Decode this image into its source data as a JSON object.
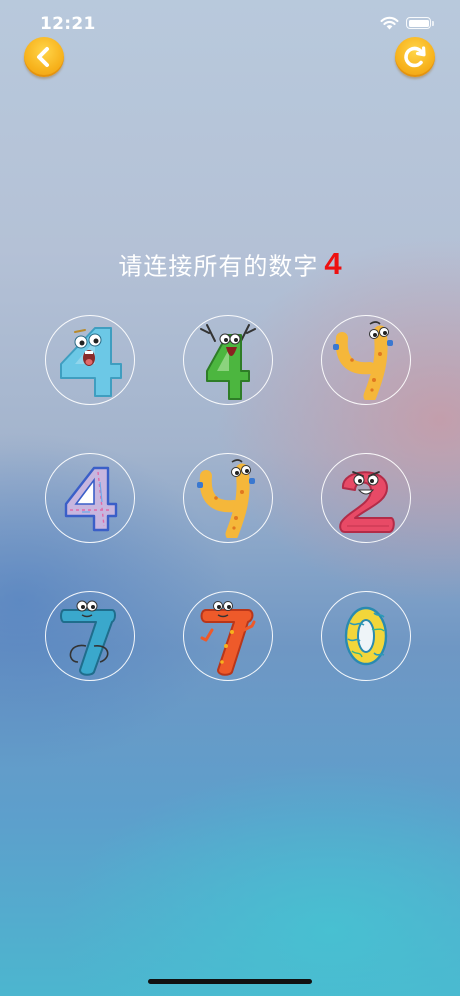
{
  "status_bar": {
    "time": "12:21"
  },
  "prompt": {
    "text": "请连接所有的数字",
    "target": "4"
  },
  "buttons": {
    "back_icon": "chevron-left-icon",
    "restart_icon": "refresh-icon"
  },
  "colors": {
    "button_yellow": "#f7b21c",
    "target_red": "#ee1010"
  },
  "cells": [
    {
      "digit": "4",
      "style": "cyan-cartoon"
    },
    {
      "digit": "4",
      "style": "green-cartoon"
    },
    {
      "digit": "4",
      "style": "yellow-cartoon"
    },
    {
      "digit": "4",
      "style": "blue-outline-pattern"
    },
    {
      "digit": "4",
      "style": "yellow-cartoon"
    },
    {
      "digit": "2",
      "style": "red-cartoon"
    },
    {
      "digit": "7",
      "style": "teal-cartoon"
    },
    {
      "digit": "7",
      "style": "orange-cartoon"
    },
    {
      "digit": "0",
      "style": "yellow-teal-pattern"
    }
  ]
}
